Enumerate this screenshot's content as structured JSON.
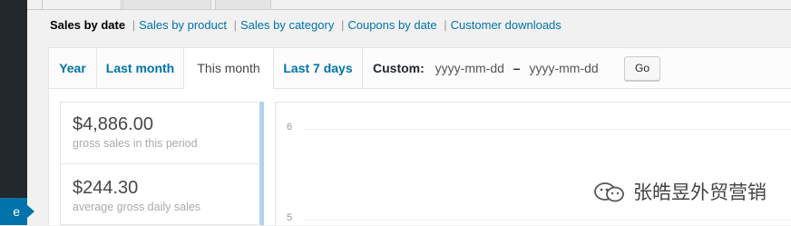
{
  "sidebar": {
    "active_item_text": "e"
  },
  "report_links": {
    "current": "Sales by date",
    "links": [
      "Sales by product",
      "Sales by category",
      "Coupons by date",
      "Customer downloads"
    ]
  },
  "range": {
    "tabs": [
      "Year",
      "Last month",
      "This month",
      "Last 7 days"
    ],
    "active_tab": "This month",
    "custom_label": "Custom:",
    "start_placeholder": "yyyy-mm-dd",
    "separator": "–",
    "end_placeholder": "yyyy-mm-dd",
    "go_label": "Go"
  },
  "legend": {
    "items": [
      {
        "amount": "$4,886.00",
        "desc": "gross sales in this period"
      },
      {
        "amount": "$244.30",
        "desc": "average gross daily sales"
      }
    ]
  },
  "chart": {
    "y_ticks": [
      "6",
      "5"
    ]
  },
  "watermark": {
    "text": "张皓昱外贸营销"
  }
}
